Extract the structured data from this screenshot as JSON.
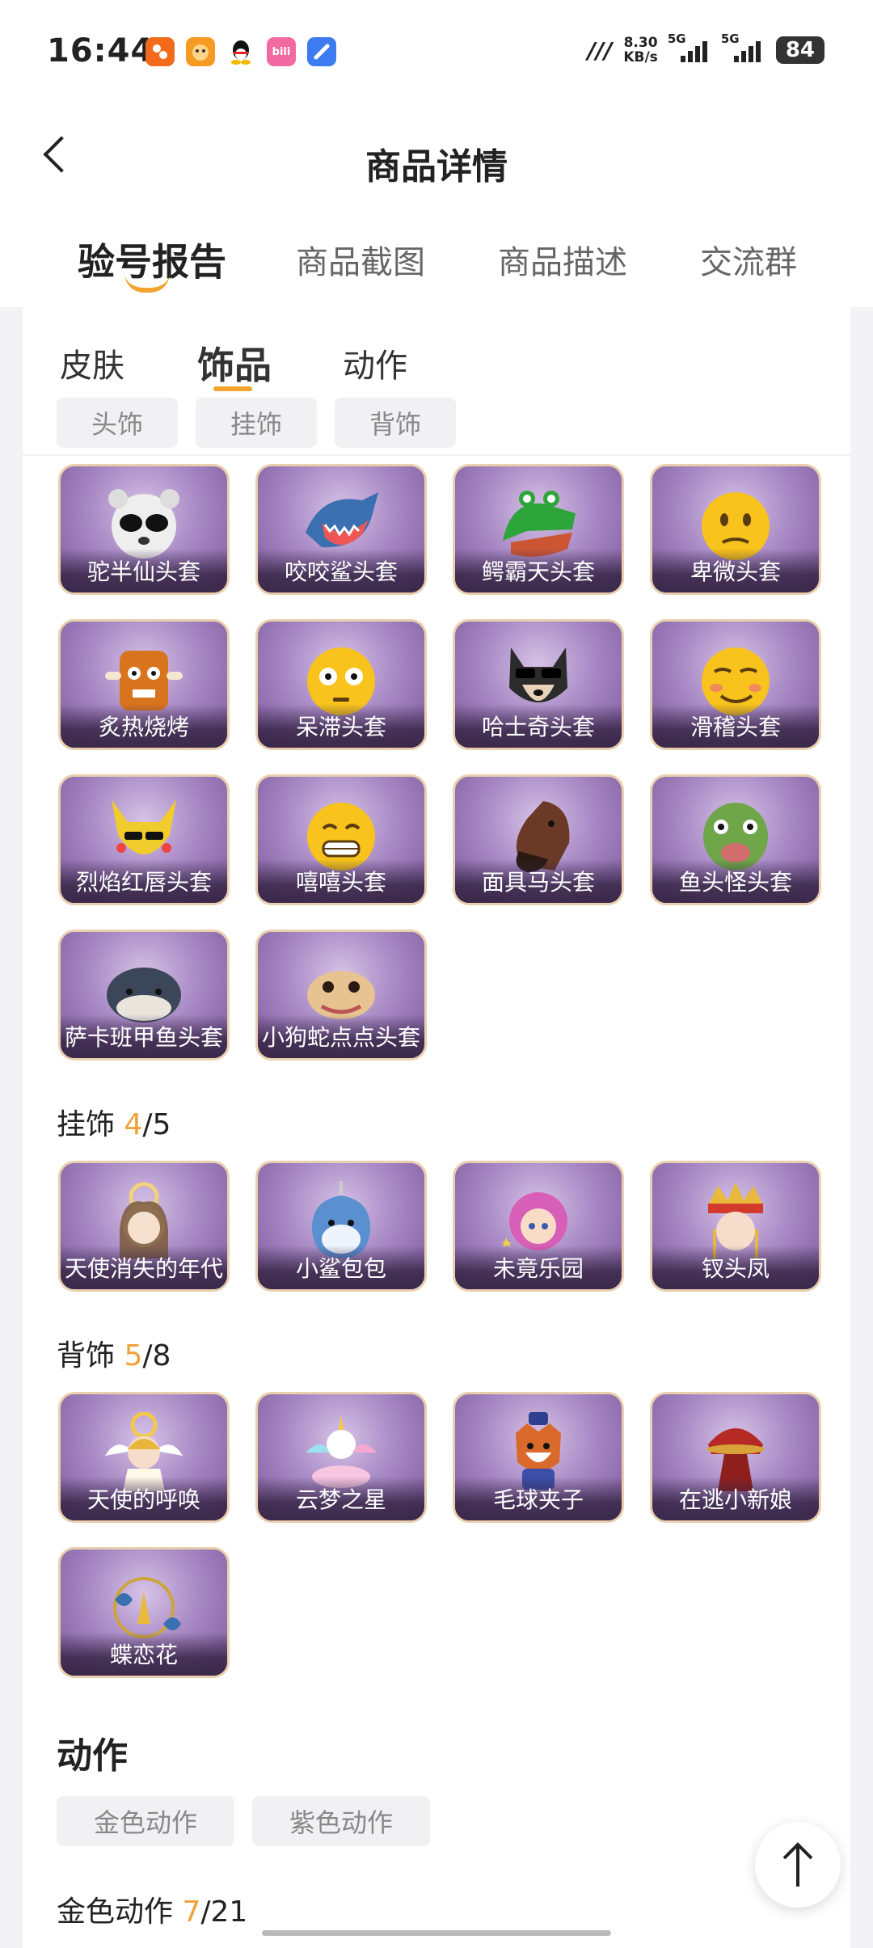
{
  "status_bar": {
    "time": "16:44",
    "net_speed_value": "8.30",
    "net_speed_unit": "KB/s",
    "sim1": "5G",
    "sim2": "5G",
    "battery": "84",
    "app_icons": [
      "meituan-icon",
      "taobao-game-icon",
      "qq-icon",
      "bilibili-icon",
      "browser-icon"
    ],
    "bilibili_text": "bili"
  },
  "header": {
    "title": "商品详情"
  },
  "main_tabs": [
    {
      "label": "验号报告",
      "active": true
    },
    {
      "label": "商品截图"
    },
    {
      "label": "商品描述"
    },
    {
      "label": "交流群"
    }
  ],
  "sub_tabs": [
    {
      "label": "皮肤"
    },
    {
      "label": "饰品",
      "active": true
    },
    {
      "label": "动作"
    }
  ],
  "accessory_filters": [
    "头饰",
    "挂饰",
    "背饰"
  ],
  "headwear": [
    {
      "name": "驼半仙头套",
      "icon": "raccoon-mask"
    },
    {
      "name": "咬咬鲨头套",
      "icon": "shark-mask"
    },
    {
      "name": "鳄霸天头套",
      "icon": "crocodile-mask"
    },
    {
      "name": "卑微头套",
      "icon": "humble-emoji-mask"
    },
    {
      "name": "炙热烧烤",
      "icon": "bbq-mask"
    },
    {
      "name": "呆滞头套",
      "icon": "dazed-emoji-mask"
    },
    {
      "name": "哈士奇头套",
      "icon": "husky-mask"
    },
    {
      "name": "滑稽头套",
      "icon": "funny-emoji-mask"
    },
    {
      "name": "烈焰红唇头套",
      "icon": "pikachu-mask"
    },
    {
      "name": "嘻嘻头套",
      "icon": "grin-emoji-mask"
    },
    {
      "name": "面具马头套",
      "icon": "horse-mask"
    },
    {
      "name": "鱼头怪头套",
      "icon": "fish-mask"
    },
    {
      "name": "萨卡班甲鱼头套",
      "icon": "sacabambaspis-mask"
    },
    {
      "name": "小狗蛇点点头套",
      "icon": "snake-mask"
    }
  ],
  "pendant_section": {
    "title": "挂饰",
    "owned": "4",
    "total": "/5"
  },
  "pendants": [
    {
      "name": "天使消失的年代",
      "icon": "angel-girl"
    },
    {
      "name": "小鲨包包",
      "icon": "shark-bag"
    },
    {
      "name": "未竟乐园",
      "icon": "paradise-doll"
    },
    {
      "name": "钗头凤",
      "icon": "phoenix-crown-doll"
    }
  ],
  "back_section": {
    "title": "背饰",
    "owned": "5",
    "total": "/8"
  },
  "back_items": [
    {
      "name": "天使的呼唤",
      "icon": "angel-call"
    },
    {
      "name": "云梦之星",
      "icon": "unicorn-star"
    },
    {
      "name": "毛球夹子",
      "icon": "fox-clip"
    },
    {
      "name": "在逃小新娘",
      "icon": "bride-dress"
    },
    {
      "name": "蝶恋花",
      "icon": "butterfly-flower"
    }
  ],
  "actions_section": {
    "title": "动作"
  },
  "action_filters": [
    "金色动作",
    "紫色动作"
  ],
  "gold_actions": {
    "title": "金色动作",
    "owned": "7",
    "total": "/21"
  },
  "colors": {
    "accent": "#f3a42e",
    "tile_purple": "#a98bc6"
  }
}
